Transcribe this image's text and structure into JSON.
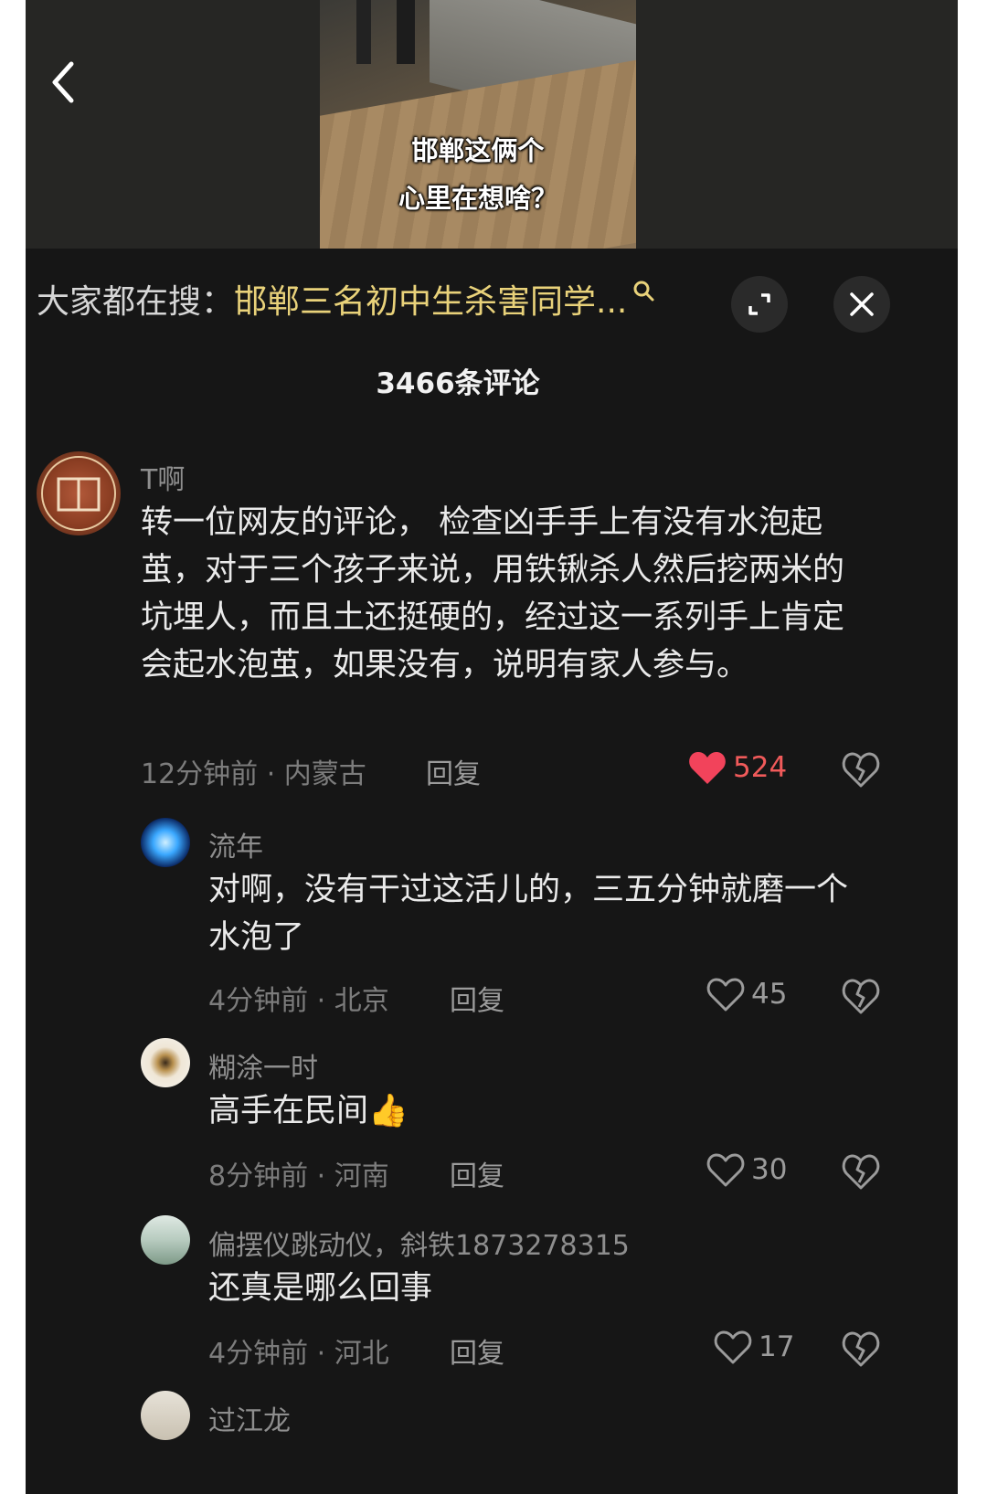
{
  "video": {
    "caption_line1": "邯郸这俩个",
    "caption_line2": "心里在想啥？"
  },
  "search_bar": {
    "prefix": "大家都在搜：",
    "query": "邯郸三名初中生杀害同学..."
  },
  "comments_header": {
    "count_label": "3466条评论"
  },
  "comments": [
    {
      "username": "T啊",
      "text": "转一位网友的评论， 检查凶手手上有没有水泡起茧，对于三个孩子来说，用铁锹杀人然后挖两米的坑埋人，而且土还挺硬的，经过这一系列手上肯定会起水泡茧，如果没有，说明有家人参与。",
      "meta": "12分钟前 · 内蒙古",
      "reply_label": "回复",
      "likes": "524",
      "liked": true
    },
    {
      "username": "流年",
      "text": "对啊，没有干过这活儿的，三五分钟就磨一个水泡了",
      "meta": "4分钟前 · 北京",
      "reply_label": "回复",
      "likes": "45",
      "liked": false
    },
    {
      "username": "糊涂一时",
      "text": "高手在民间👍",
      "meta": "8分钟前 · 河南",
      "reply_label": "回复",
      "likes": "30",
      "liked": false
    },
    {
      "username": "偏摆仪跳动仪，斜铁1873278315",
      "text": "还真是哪么回事",
      "meta": "4分钟前 · 河北",
      "reply_label": "回复",
      "likes": "17",
      "liked": false
    },
    {
      "username": "过江龙"
    }
  ],
  "colors": {
    "background": "#161616",
    "search_highlight": "#e9d27a",
    "like_active": "#f05a5a"
  },
  "icons": {
    "back": "chevron-left-icon",
    "search": "search-icon",
    "expand": "expand-icon",
    "close": "close-icon",
    "like": "heart-icon",
    "dislike": "broken-heart-icon"
  }
}
